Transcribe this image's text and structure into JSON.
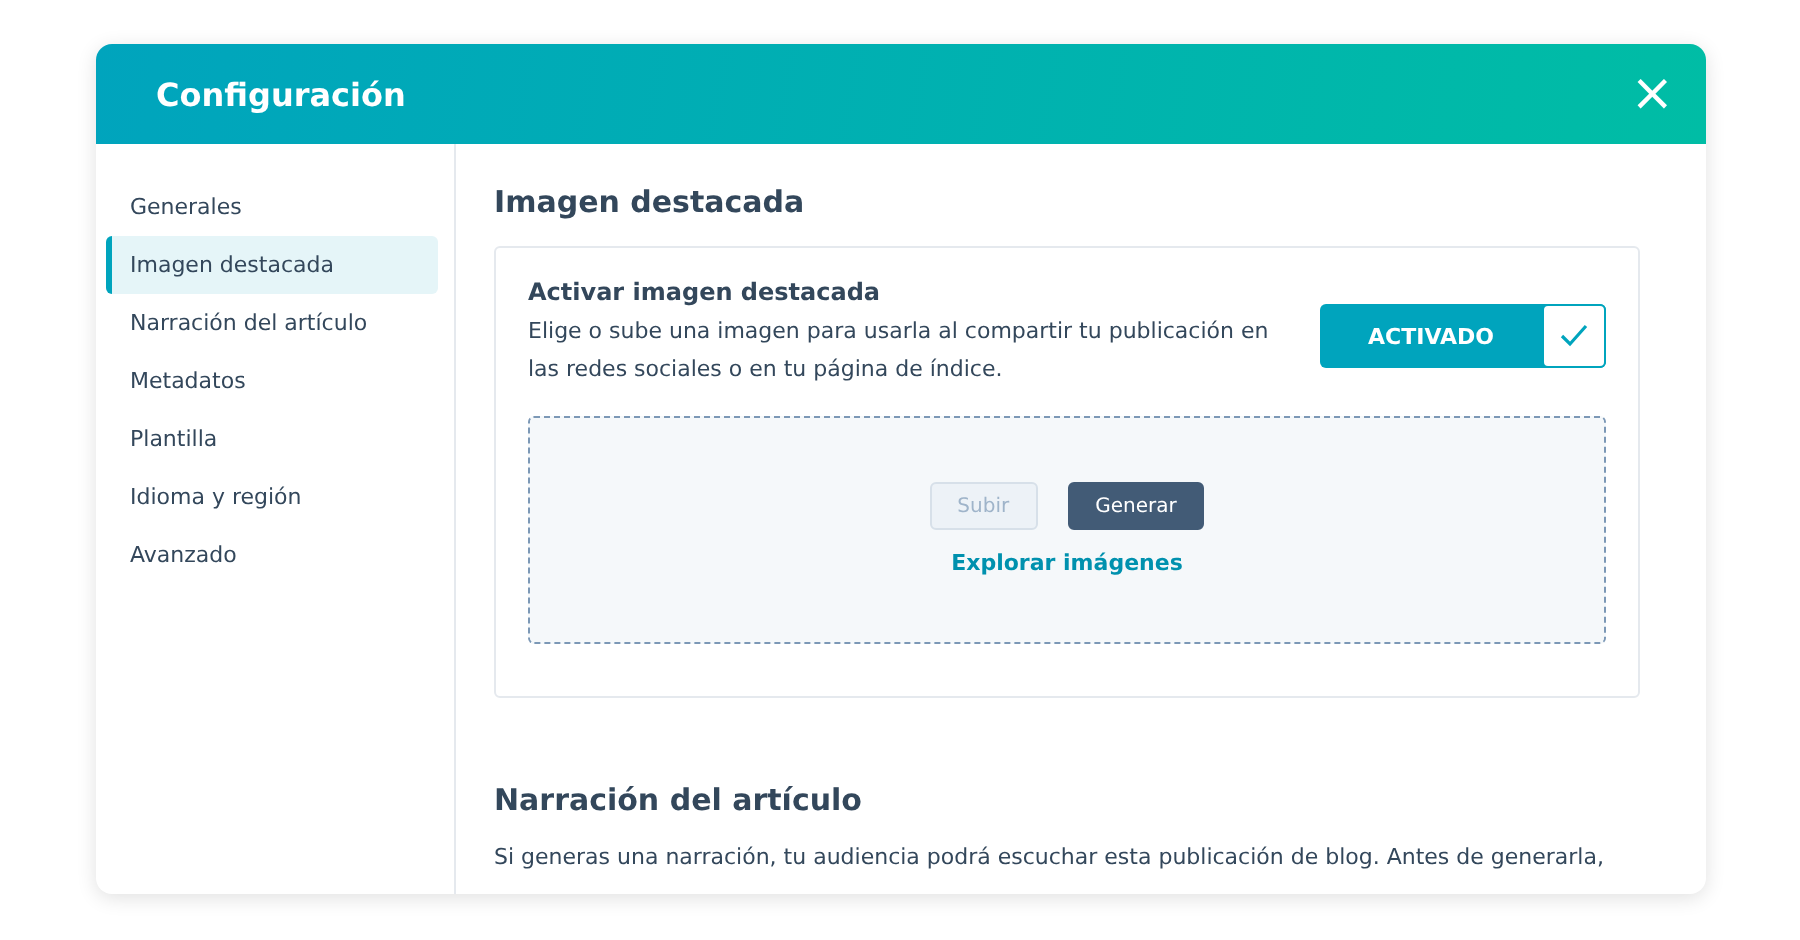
{
  "window": {
    "title": "Configuración",
    "close": "×"
  },
  "sidebar": {
    "items": [
      {
        "label": "Generales",
        "selected": false
      },
      {
        "label": "Imagen destacada",
        "selected": true
      },
      {
        "label": "Narración del artículo",
        "selected": false
      },
      {
        "label": "Metadatos",
        "selected": false
      },
      {
        "label": "Plantilla",
        "selected": false
      },
      {
        "label": "Idioma y región",
        "selected": false
      },
      {
        "label": "Avanzado",
        "selected": false
      }
    ]
  },
  "sections": [
    {
      "title": "Imagen destacada",
      "card": {
        "title": "Activar imagen destacada",
        "description": "Elige o sube una imagen para usarla al compartir tu publicación en las redes sociales o en tu página de índice.",
        "toggle": {
          "label": "ACTIVADO",
          "on": true
        },
        "buttons": [
          {
            "label": "Subir",
            "kind": "secondary",
            "disabled": true
          },
          {
            "label": "Generar",
            "kind": "primary",
            "disabled": false
          }
        ],
        "link": "Explorar imágenes"
      }
    },
    {
      "title": "Narración del artículo",
      "text": "Si generas una narración, tu audiencia podrá escuchar esta publicación de blog. Antes de generarla,"
    }
  ]
}
